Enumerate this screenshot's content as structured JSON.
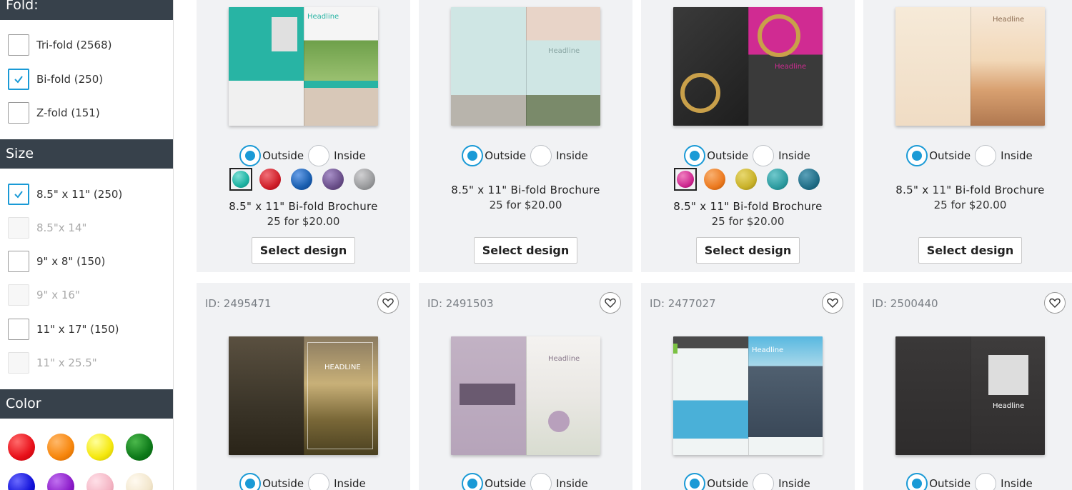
{
  "sidebar": {
    "fold": {
      "title": "Fold:",
      "options": [
        {
          "label": "Tri-fold (2568)",
          "checked": false
        },
        {
          "label": "Bi-fold (250)",
          "checked": true
        },
        {
          "label": "Z-fold (151)",
          "checked": false
        }
      ]
    },
    "size": {
      "title": "Size",
      "options": [
        {
          "label": "8.5\" x 11\" (250)",
          "checked": true
        },
        {
          "label": "8.5\"x 14\"",
          "disabled": true
        },
        {
          "label": "9\" x 8\" (150)",
          "checked": false
        },
        {
          "label": "9\" x 16\"",
          "disabled": true
        },
        {
          "label": "11\" x 17\" (150)",
          "checked": false
        },
        {
          "label": "11\" x 25.5\"",
          "disabled": true
        }
      ]
    },
    "color": {
      "title": "Color",
      "swatches": [
        "#e8101a",
        "#f7860c",
        "#f5e80f",
        "#0e7a1a",
        "#1010d8",
        "#8a1ac8",
        "#f4b5c4",
        "#f2e6cc"
      ]
    }
  },
  "cards_top": [
    {
      "outside": "Outside",
      "inside": "Inside",
      "colors": [
        "#1eb3a3",
        "#d0202a",
        "#1a5fb0",
        "#6a4f8a",
        "#9a9b9d"
      ],
      "title": "8.5\" x 11\" Bi-fold Brochure",
      "price": "25 for $20.00",
      "button": "Select design",
      "headline": "Headline"
    },
    {
      "outside": "Outside",
      "inside": "Inside",
      "colors": [],
      "title": "8.5\" x 11\" Bi-fold Brochure",
      "price": "25 for $20.00",
      "button": "Select design",
      "headline": "Headline"
    },
    {
      "outside": "Outside",
      "inside": "Inside",
      "colors": [
        "#d02b92",
        "#ec7a20",
        "#c9b22a",
        "#2e9ca0",
        "#226f88"
      ],
      "title": "8.5\" x 11\" Bi-fold Brochure",
      "price": "25 for $20.00",
      "button": "Select design",
      "headline": "Headline"
    },
    {
      "outside": "Outside",
      "inside": "Inside",
      "colors": [],
      "title": "8.5\" x 11\" Bi-fold Brochure",
      "price": "25 for $20.00",
      "button": "Select design",
      "headline": "Headline"
    }
  ],
  "cards_bottom": [
    {
      "id": "ID: 2495471",
      "outside": "Outside",
      "inside": "Inside",
      "headline": "HEADLINE"
    },
    {
      "id": "ID: 2491503",
      "outside": "Outside",
      "inside": "Inside",
      "headline": "Headline"
    },
    {
      "id": "ID: 2477027",
      "outside": "Outside",
      "inside": "Inside",
      "headline": "Headline"
    },
    {
      "id": "ID: 2500440",
      "outside": "Outside",
      "inside": "Inside",
      "headline": "Headline"
    }
  ]
}
